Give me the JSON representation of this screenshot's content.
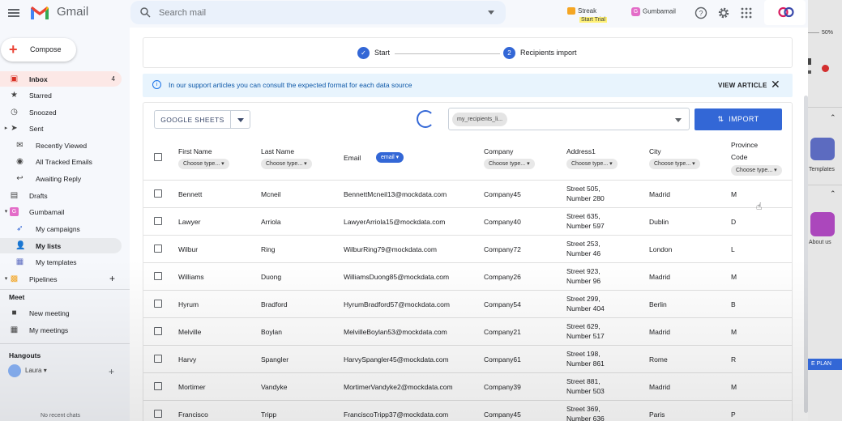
{
  "header": {
    "app_name": "Gmail",
    "search_placeholder": "Search mail",
    "streak_label": "Streak",
    "streak_trial": "Start Trial",
    "gumbamail_label": "Gumbamail"
  },
  "sidebar": {
    "compose_label": "Compose",
    "items": [
      {
        "label": "Inbox",
        "count": "4"
      },
      {
        "label": "Starred"
      },
      {
        "label": "Snoozed"
      },
      {
        "label": "Sent"
      },
      {
        "label": "Recently Viewed"
      },
      {
        "label": "All Tracked Emails"
      },
      {
        "label": "Awaiting Reply"
      },
      {
        "label": "Drafts"
      },
      {
        "label": "Gumbamail"
      },
      {
        "label": "My campaigns"
      },
      {
        "label": "My lists"
      },
      {
        "label": "My templates"
      },
      {
        "label": "Pipelines"
      }
    ],
    "meet_title": "Meet",
    "meet_items": [
      {
        "label": "New meeting"
      },
      {
        "label": "My meetings"
      }
    ],
    "hangouts_title": "Hangouts",
    "hangouts_user": "Laura",
    "no_recent": "No recent chats"
  },
  "right_panel": {
    "zoom_text": "50%",
    "templates_label": "Templates",
    "about_label": "About us",
    "plan_label": "E PLAN"
  },
  "main": {
    "steps": [
      {
        "number": "✓",
        "label": "Start"
      },
      {
        "number": "2",
        "label": "Recipients import"
      }
    ],
    "info_text": "In our support articles you can consult the expected format for each data source",
    "view_article": "VIEW ARTICLE",
    "google_sheets": "GOOGLE SHEETS",
    "selected_sheet": "my_recipients_li...",
    "import_label": "IMPORT",
    "columns": [
      {
        "label": "First Name",
        "type": "Choose type..."
      },
      {
        "label": "Last Name",
        "type": "Choose type..."
      },
      {
        "label": "Email",
        "type": "email"
      },
      {
        "label": "Company",
        "type": "Choose type..."
      },
      {
        "label": "Address1",
        "type": "Choose type..."
      },
      {
        "label": "City",
        "type": "Choose type..."
      },
      {
        "label": "Province",
        "label2": "Code",
        "type": "Choose type..."
      }
    ],
    "rows": [
      {
        "first": "Bennett",
        "last": "Mcneil",
        "email": "BennettMcneil13@mockdata.com",
        "company": "Company45",
        "addr1": "Street 505,",
        "addr2": "Number 280",
        "city": "Madrid",
        "prov": "M"
      },
      {
        "first": "Lawyer",
        "last": "Arriola",
        "email": "LawyerArriola15@mockdata.com",
        "company": "Company40",
        "addr1": "Street 635,",
        "addr2": "Number 597",
        "city": "Dublin",
        "prov": "D"
      },
      {
        "first": "Wilbur",
        "last": "Ring",
        "email": "WilburRing79@mockdata.com",
        "company": "Company72",
        "addr1": "Street 253,",
        "addr2": "Number 46",
        "city": "London",
        "prov": "L"
      },
      {
        "first": "Williams",
        "last": "Duong",
        "email": "WilliamsDuong85@mockdata.com",
        "company": "Company26",
        "addr1": "Street 923,",
        "addr2": "Number 96",
        "city": "Madrid",
        "prov": "M"
      },
      {
        "first": "Hyrum",
        "last": "Bradford",
        "email": "HyrumBradford57@mockdata.com",
        "company": "Company54",
        "addr1": "Street 299,",
        "addr2": "Number 404",
        "city": "Berlin",
        "prov": "B"
      },
      {
        "first": "Melville",
        "last": "Boylan",
        "email": "MelvilleBoylan53@mockdata.com",
        "company": "Company21",
        "addr1": "Street 629,",
        "addr2": "Number 517",
        "city": "Madrid",
        "prov": "M"
      },
      {
        "first": "Harvy",
        "last": "Spangler",
        "email": "HarvySpangler45@mockdata.com",
        "company": "Company61",
        "addr1": "Street 198,",
        "addr2": "Number 861",
        "city": "Rome",
        "prov": "R"
      },
      {
        "first": "Mortimer",
        "last": "Vandyke",
        "email": "MortimerVandyke2@mockdata.com",
        "company": "Company39",
        "addr1": "Street 881,",
        "addr2": "Number 503",
        "city": "Madrid",
        "prov": "M"
      },
      {
        "first": "Francisco",
        "last": "Tripp",
        "email": "FranciscoTripp37@mockdata.com",
        "company": "Company45",
        "addr1": "Street 369,",
        "addr2": "Number 636",
        "city": "Paris",
        "prov": "P"
      }
    ]
  }
}
